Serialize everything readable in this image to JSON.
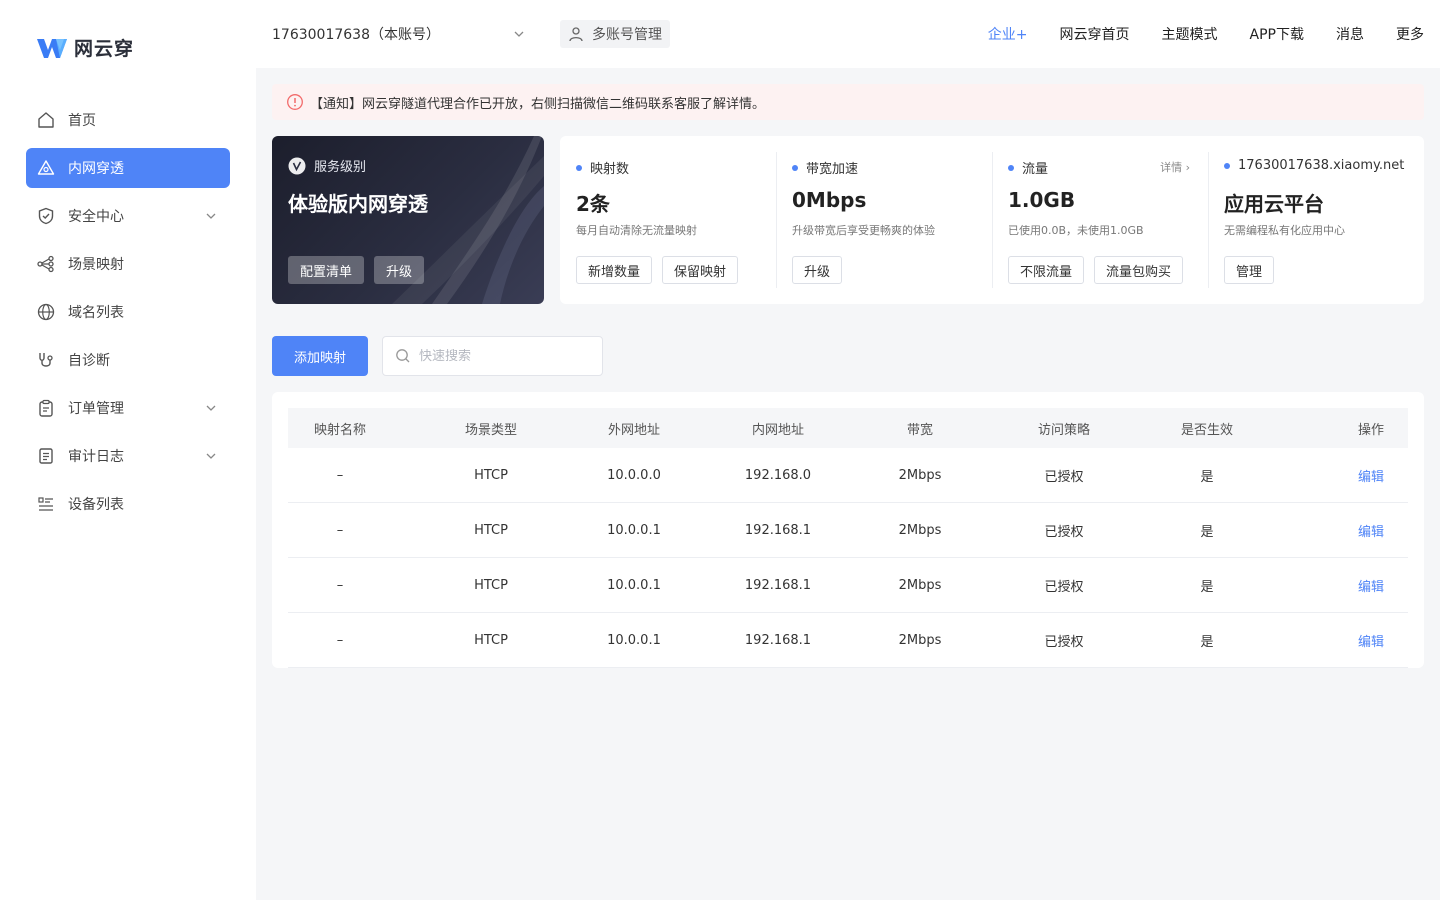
{
  "app": {
    "logo_text": "网云穿"
  },
  "sidebar": {
    "items": [
      {
        "label": "首页",
        "icon": "home-icon",
        "active": false,
        "has_children": false
      },
      {
        "label": "内网穿透",
        "icon": "triangle-icon",
        "active": true,
        "has_children": false
      },
      {
        "label": "安全中心",
        "icon": "shield-check-icon",
        "active": false,
        "has_children": true
      },
      {
        "label": "场景映射",
        "icon": "share-nodes-icon",
        "active": false,
        "has_children": false
      },
      {
        "label": "域名列表",
        "icon": "globe-icon",
        "active": false,
        "has_children": false
      },
      {
        "label": "自诊断",
        "icon": "stethoscope-icon",
        "active": false,
        "has_children": false
      },
      {
        "label": "订单管理",
        "icon": "clipboard-icon",
        "active": false,
        "has_children": true
      },
      {
        "label": "审计日志",
        "icon": "document-icon",
        "active": false,
        "has_children": true
      },
      {
        "label": "设备列表",
        "icon": "list-icon",
        "active": false,
        "has_children": false
      }
    ]
  },
  "header": {
    "account": "17630017638（本账号）",
    "multi_account": "多账号管理",
    "nav": [
      {
        "label": "企业+",
        "accent": true
      },
      {
        "label": "网云穿首页",
        "accent": false
      },
      {
        "label": "主题模式",
        "accent": false
      },
      {
        "label": "APP下载",
        "accent": false
      },
      {
        "label": "消息",
        "accent": false
      },
      {
        "label": "更多",
        "accent": false
      }
    ]
  },
  "notice": {
    "text": "【通知】网云穿隧道代理合作已开放，右侧扫描微信二维码联系客服了解详情。"
  },
  "service": {
    "label": "服务级别",
    "title": "体验版内网穿透",
    "buttons": [
      "配置清单",
      "升级"
    ]
  },
  "stats": [
    {
      "label": "映射数",
      "value": "2条",
      "sub": "每月自动清除无流量映射",
      "detail": "",
      "buttons": [
        "新增数量",
        "保留映射"
      ]
    },
    {
      "label": "带宽加速",
      "value": "0Mbps",
      "sub": "升级带宽后享受更畅爽的体验",
      "detail": "",
      "buttons": [
        "升级"
      ]
    },
    {
      "label": "流量",
      "value": "1.0GB",
      "sub": "已使用0.0B，未使用1.0GB",
      "detail": "详情 ›",
      "buttons": [
        "不限流量",
        "流量包购买"
      ]
    },
    {
      "label": "17630017638.xiaomy.net",
      "value": "应用云平台",
      "sub": "无需编程私有化应用中心",
      "detail": "",
      "buttons": [
        "管理"
      ]
    }
  ],
  "toolbar": {
    "add_label": "添加映射",
    "search_placeholder": "快速搜索"
  },
  "table": {
    "columns": [
      "映射名称",
      "场景类型",
      "外网地址",
      "内网地址",
      "带宽",
      "访问策略",
      "是否生效",
      "操作"
    ],
    "rows": [
      [
        "–",
        "HTCP",
        "10.0.0.0",
        "192.168.0",
        "2Mbps",
        "已授权",
        "是",
        "编辑"
      ],
      [
        "–",
        "HTCP",
        "10.0.0.1",
        "192.168.1",
        "2Mbps",
        "已授权",
        "是",
        "编辑"
      ],
      [
        "–",
        "HTCP",
        "10.0.0.1",
        "192.168.1",
        "2Mbps",
        "已授权",
        "是",
        "编辑"
      ],
      [
        "–",
        "HTCP",
        "10.0.0.1",
        "192.168.1",
        "2Mbps",
        "已授权",
        "是",
        "编辑"
      ]
    ]
  },
  "colors": {
    "accent": "#4f84f7",
    "notice_bg": "#fdf2f2",
    "notice_icon": "#f26b6b",
    "service_bg": "#1c1e2c"
  }
}
